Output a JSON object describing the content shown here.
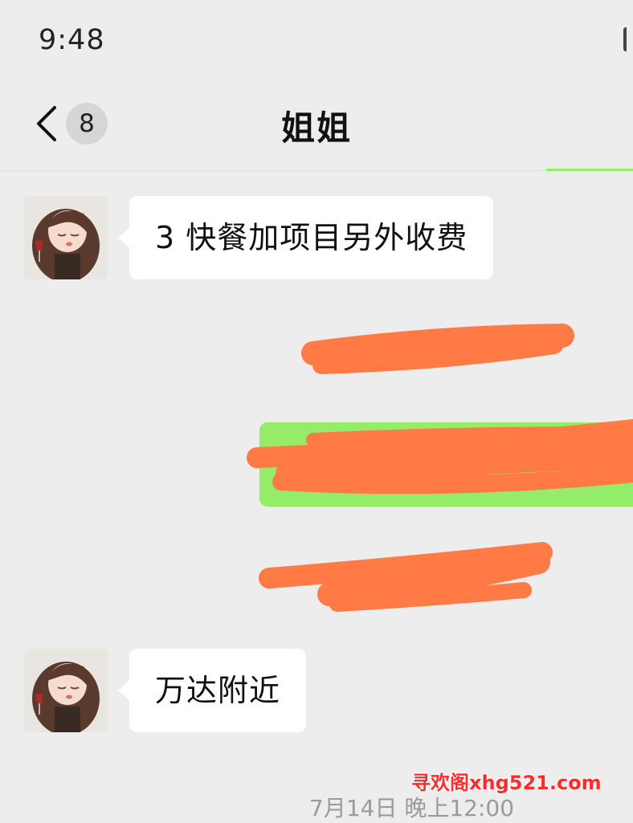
{
  "status_bar": {
    "time": "9:48"
  },
  "header": {
    "title": "姐姐",
    "unread_count": "8",
    "back_icon": "chevron-left-icon"
  },
  "colors": {
    "background": "#ededed",
    "incoming_bubble": "#ffffff",
    "outgoing_bubble": "#95ec69",
    "redaction": "#ff7a45",
    "watermark": "#ff2b2b"
  },
  "messages": [
    {
      "direction": "incoming",
      "text": "3 快餐加项目另外收费"
    },
    {
      "direction": "redacted-timestamp"
    },
    {
      "direction": "outgoing",
      "redacted": true
    },
    {
      "direction": "redacted-timestamp"
    },
    {
      "direction": "incoming",
      "text": "万达附近"
    }
  ],
  "footer": {
    "timestamp": "7月14日 晚上12:00",
    "watermark": "寻欢阁xhg521.com"
  }
}
